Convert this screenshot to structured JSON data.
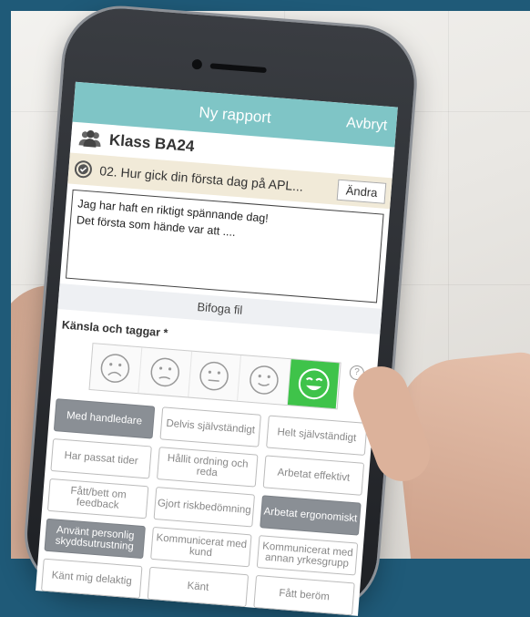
{
  "header": {
    "title": "Ny rapport",
    "cancel_label": "Avbryt"
  },
  "class_row": {
    "name": "Klass BA24",
    "icon": "group-icon"
  },
  "question": {
    "text": "02. Hur gick din första dag på APL...",
    "change_label": "Ändra",
    "icon": "check-circle-icon"
  },
  "report_text": {
    "lines": [
      "Jag har haft en riktigt spännande dag!",
      "Det första som hände var att ...."
    ]
  },
  "attach_label": "Bifoga fil",
  "feelings": {
    "label": "Känsla och taggar *",
    "help": "?",
    "faces": [
      "very-sad",
      "sad",
      "neutral",
      "happy",
      "very-happy"
    ],
    "selected_index": 4,
    "active_color": "#3fc34a"
  },
  "tags": [
    {
      "label": "Med handledare",
      "selected": true
    },
    {
      "label": "Delvis självständigt",
      "selected": false
    },
    {
      "label": "Helt självständigt",
      "selected": false
    },
    {
      "label": "Har passat tider",
      "selected": false
    },
    {
      "label": "Hållit ordning och reda",
      "selected": false
    },
    {
      "label": "Arbetat effektivt",
      "selected": false
    },
    {
      "label": "Fått/bett om feedback",
      "selected": false
    },
    {
      "label": "Gjort riskbedömning",
      "selected": false
    },
    {
      "label": "Arbetat ergonomiskt",
      "selected": true
    },
    {
      "label": "Använt personlig skyddsutrustning",
      "selected": true
    },
    {
      "label": "Kommunicerat med kund",
      "selected": false
    },
    {
      "label": "Kommunicerat med annan yrkesgrupp",
      "selected": false
    },
    {
      "label": "Känt mig delaktig",
      "selected": false
    },
    {
      "label": "Känt",
      "selected": false
    },
    {
      "label": "Fått beröm",
      "selected": false
    }
  ],
  "colors": {
    "header": "#7fc5c6",
    "question_bg": "#f1ead8",
    "tag_selected": "#8a8f95",
    "background": "#1f5a78"
  }
}
